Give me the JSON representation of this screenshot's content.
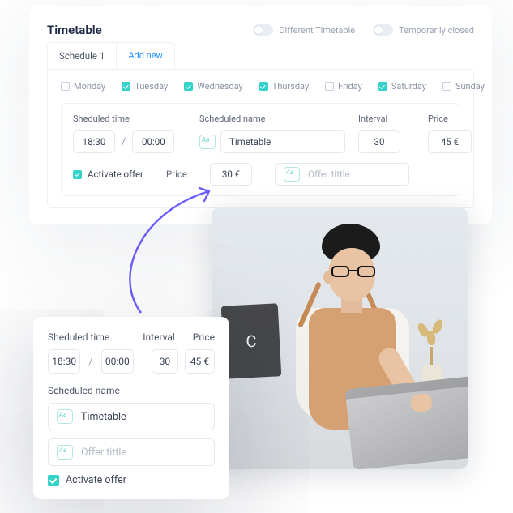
{
  "top": {
    "title": "Timetable",
    "toggles": {
      "diff": "Different  Timetable",
      "closed": "Temporarily closed"
    },
    "tabs": {
      "schedule": "Schedule 1",
      "add": "Add new"
    },
    "days": [
      {
        "name": "Monday",
        "on": false
      },
      {
        "name": "Tuesday",
        "on": true
      },
      {
        "name": "Wednesday",
        "on": true
      },
      {
        "name": "Thursday",
        "on": true
      },
      {
        "name": "Friday",
        "on": false
      },
      {
        "name": "Saturday",
        "on": true
      },
      {
        "name": "Sunday",
        "on": false
      }
    ],
    "labels": {
      "time": "Sheduled time",
      "name": "Scheduled name",
      "interval": "Interval",
      "price": "Price"
    },
    "values": {
      "from": "18:30",
      "to": "00:00",
      "name": "Timetable",
      "interval": "30",
      "price": "45 €"
    },
    "activate": "Activate offer",
    "priceLabel": "Price",
    "priceValue": "30 €",
    "offerPlaceholder": "Offer tittle"
  },
  "bot": {
    "labels": {
      "time": "Sheduled time",
      "interval": "Interval",
      "price": "Price",
      "name": "Scheduled name"
    },
    "values": {
      "from": "18:30",
      "to": "00:00",
      "interval": "30",
      "price": "45 €",
      "name": "Timetable"
    },
    "offerPlaceholder": "Offer tittle",
    "activate": "Activate offer"
  },
  "photo": {
    "board": "C"
  }
}
